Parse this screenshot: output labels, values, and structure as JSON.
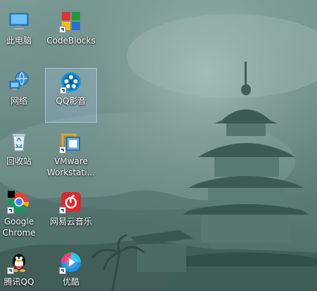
{
  "desktop": {
    "icons": [
      {
        "label": "此电脑",
        "icon": "computer-icon"
      },
      {
        "label": "CodeBlocks",
        "icon": "codeblocks-icon"
      },
      {
        "label": "网络",
        "icon": "network-icon"
      },
      {
        "label": "QQ影音",
        "icon": "qq-player-icon"
      },
      {
        "label": "回收站",
        "icon": "recycle-bin-icon"
      },
      {
        "label": "VMware\nWorkstati...",
        "icon": "vmware-icon"
      },
      {
        "label": "Google\nChrome",
        "icon": "chrome-icon"
      },
      {
        "label": "网易云音乐",
        "icon": "netease-music-icon"
      },
      {
        "label": "腾讯QQ",
        "icon": "qq-penguin-icon"
      },
      {
        "label": "优酷",
        "icon": "youku-icon"
      }
    ]
  }
}
